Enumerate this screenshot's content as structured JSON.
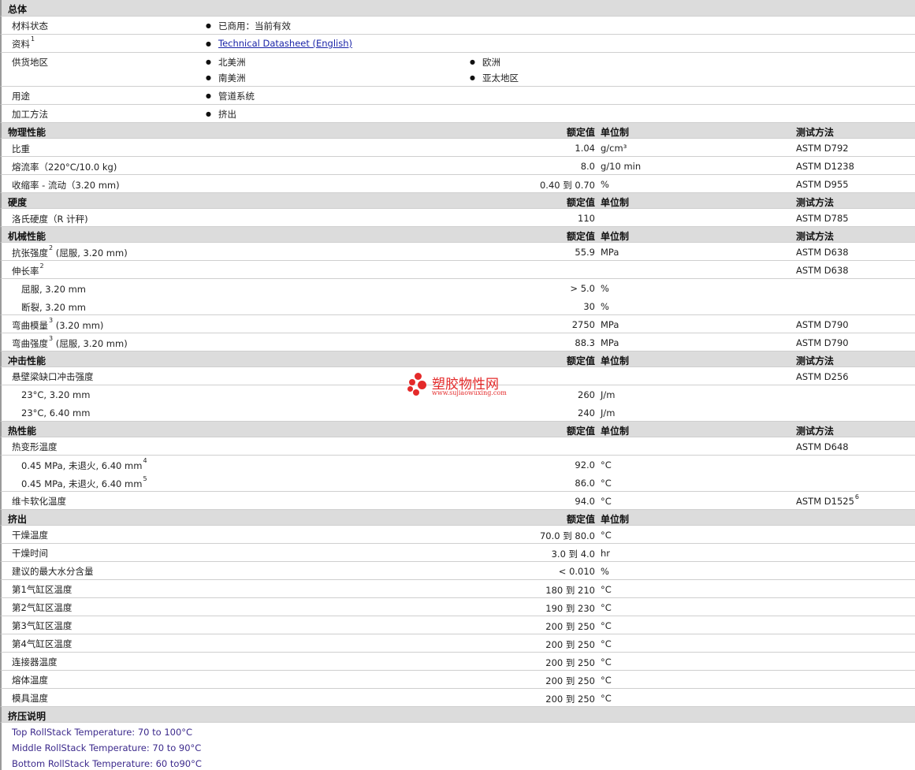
{
  "general": {
    "title": "总体",
    "rows": {
      "status": {
        "label": "材料状态",
        "value": "已商用：当前有效"
      },
      "docs": {
        "label": "资料",
        "sup": "1",
        "link": "Technical Datasheet (English)"
      },
      "availability": {
        "label": "供货地区",
        "v1": "北美洲",
        "v2": "欧洲",
        "v3": "南美洲",
        "v4": "亚太地区"
      },
      "uses": {
        "label": "用途",
        "value": "管道系统"
      },
      "processing": {
        "label": "加工方法",
        "value": "挤出"
      }
    }
  },
  "col_headers": {
    "value": "额定值",
    "unit": "单位制",
    "method": "测试方法"
  },
  "sections": {
    "physical": {
      "title": "物理性能",
      "rows": [
        {
          "label": "比重",
          "value": "1.04",
          "unit": "g/cm³",
          "method": "ASTM D792"
        },
        {
          "label": "熔流率（220°C/10.0 kg)",
          "value": "8.0",
          "unit": "g/10 min",
          "method": "ASTM D1238"
        },
        {
          "label": "收缩率 - 流动（3.20 mm)",
          "value": "0.40 到  0.70",
          "unit": "%",
          "method": "ASTM D955"
        }
      ]
    },
    "hardness": {
      "title": "硬度",
      "rows": [
        {
          "label": "洛氏硬度（R 计秤)",
          "value": "110",
          "unit": "",
          "method": "ASTM D785"
        }
      ]
    },
    "mechanical": {
      "title": "机械性能",
      "rows": [
        {
          "label": "抗张强度",
          "sup": "2",
          "label2": "(屈服, 3.20 mm)",
          "value": "55.9",
          "unit": "MPa",
          "method": "ASTM D638"
        },
        {
          "label": "伸长率",
          "sup": "2",
          "label2": "",
          "value": "",
          "unit": "",
          "method": "ASTM D638"
        },
        {
          "label": "屈服, 3.20 mm",
          "value": "> 5.0",
          "unit": "%",
          "method": ""
        },
        {
          "label": "断裂, 3.20 mm",
          "value": "30",
          "unit": "%",
          "method": ""
        },
        {
          "label": "弯曲模量",
          "sup": "3",
          "label2": "(3.20 mm)",
          "value": "2750",
          "unit": "MPa",
          "method": "ASTM D790"
        },
        {
          "label": "弯曲强度",
          "sup": "3",
          "label2": "(屈服, 3.20 mm)",
          "value": "88.3",
          "unit": "MPa",
          "method": "ASTM D790"
        }
      ]
    },
    "impact": {
      "title": "冲击性能",
      "rows": [
        {
          "label": "悬壁梁缺口冲击强度",
          "value": "",
          "unit": "",
          "method": "ASTM D256"
        },
        {
          "label": "23°C, 3.20 mm",
          "value": "260",
          "unit": "J/m",
          "method": ""
        },
        {
          "label": "23°C, 6.40 mm",
          "value": "240",
          "unit": "J/m",
          "method": ""
        }
      ]
    },
    "thermal": {
      "title": "热性能",
      "rows": [
        {
          "label": "热变形温度",
          "sup": "",
          "value": "",
          "unit": "",
          "method": "ASTM D648",
          "msup": ""
        },
        {
          "label": "0.45 MPa, 未退火, 6.40 mm",
          "sup": "4",
          "value": "92.0",
          "unit": "°C",
          "method": "",
          "msup": ""
        },
        {
          "label": "0.45 MPa, 未退火, 6.40 mm",
          "sup": "5",
          "value": "86.0",
          "unit": "°C",
          "method": "",
          "msup": ""
        },
        {
          "label": "维卡软化温度",
          "sup": "",
          "value": "94.0",
          "unit": "°C",
          "method": "ASTM D1525",
          "msup": "6"
        }
      ]
    },
    "extrusion": {
      "title": "挤出",
      "rows": [
        {
          "label": "干燥温度",
          "value": "70.0 到  80.0",
          "unit": "°C"
        },
        {
          "label": "干燥时间",
          "value": "3.0 到  4.0",
          "unit": "hr"
        },
        {
          "label": "建议的最大水分含量",
          "value": "< 0.010",
          "unit": "%"
        },
        {
          "label": "第1气缸区温度",
          "value": "180 到  210",
          "unit": "°C"
        },
        {
          "label": "第2气缸区温度",
          "value": "190 到  230",
          "unit": "°C"
        },
        {
          "label": "第3气缸区温度",
          "value": "200 到  250",
          "unit": "°C"
        },
        {
          "label": "第4气缸区温度",
          "value": "200 到  250",
          "unit": "°C"
        },
        {
          "label": "连接器温度",
          "value": "200 到  250",
          "unit": "°C"
        },
        {
          "label": "熔体温度",
          "value": "200 到  250",
          "unit": "°C"
        },
        {
          "label": "模具温度",
          "value": "200 到  250",
          "unit": "°C"
        }
      ]
    }
  },
  "extrusion_notes": {
    "title": "挤压说明",
    "lines": [
      "Top RollStack Temperature: 70 to 100°C",
      "Middle RollStack Temperature: 70 to 90°C",
      "Bottom RollStack Temperature: 60 to90°C"
    ]
  },
  "watermark": {
    "text": "塑胶物性网",
    "url": "www.sujiaowuxing.com",
    "color": "#e42a2a"
  }
}
